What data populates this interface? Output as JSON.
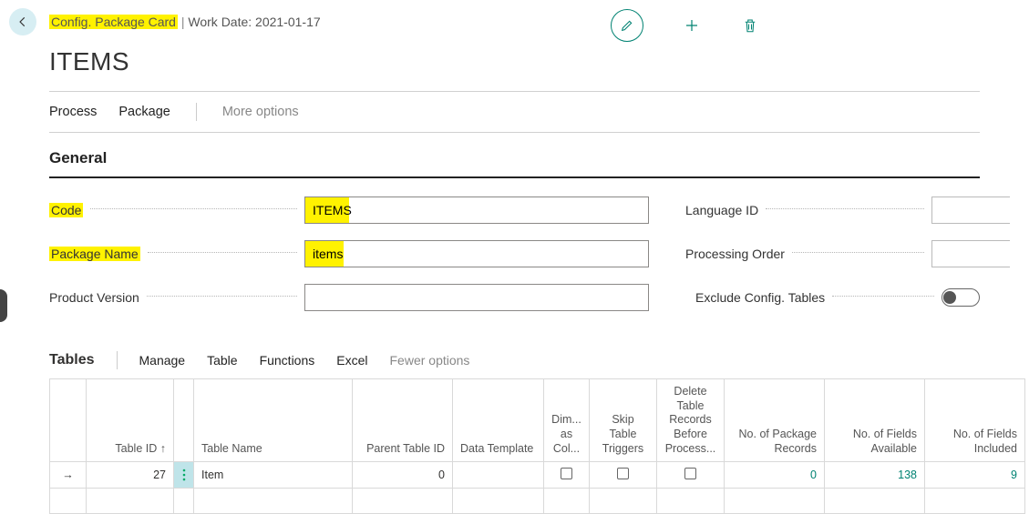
{
  "breadcrumb": {
    "page_type": "Config. Package Card",
    "work_date_label": "Work Date: 2021-01-17"
  },
  "page_title": "ITEMS",
  "top_menu": {
    "process": "Process",
    "package": "Package",
    "more": "More options"
  },
  "top_actions": {
    "edit": "edit-pencil-icon",
    "new": "plus-icon",
    "delete": "trash-icon"
  },
  "section_general": {
    "title": "General"
  },
  "fields": {
    "code": {
      "label": "Code",
      "value": "ITEMS"
    },
    "package_name": {
      "label": "Package Name",
      "value": "items"
    },
    "product_version": {
      "label": "Product Version",
      "value": ""
    },
    "language_id": {
      "label": "Language ID",
      "value": ""
    },
    "processing_order": {
      "label": "Processing Order",
      "value": ""
    },
    "exclude_config": {
      "label": "Exclude Config. Tables",
      "value": false
    }
  },
  "tables_section": {
    "title": "Tables",
    "menu": {
      "manage": "Manage",
      "table": "Table",
      "functions": "Functions",
      "excel": "Excel",
      "fewer": "Fewer options"
    },
    "columns": {
      "table_id": "Table ID ↑",
      "table_name": "Table Name",
      "parent_table_id": "Parent Table ID",
      "data_template": "Data Template",
      "dim_as_col": "Dim... as Col...",
      "skip_triggers": "Skip Table Triggers",
      "delete_before": "Delete Table Records Before Process...",
      "pkg_records": "No. of Package Records",
      "fields_avail": "No. of Fields Available",
      "fields_incl": "No. of Fields Included"
    },
    "rows": [
      {
        "table_id": 27,
        "table_name": "Item",
        "parent_table_id": 0,
        "data_template": "",
        "dim_as_col": false,
        "skip_triggers": false,
        "delete_before": false,
        "pkg_records": 0,
        "fields_avail": 138,
        "fields_incl": 9
      }
    ]
  }
}
